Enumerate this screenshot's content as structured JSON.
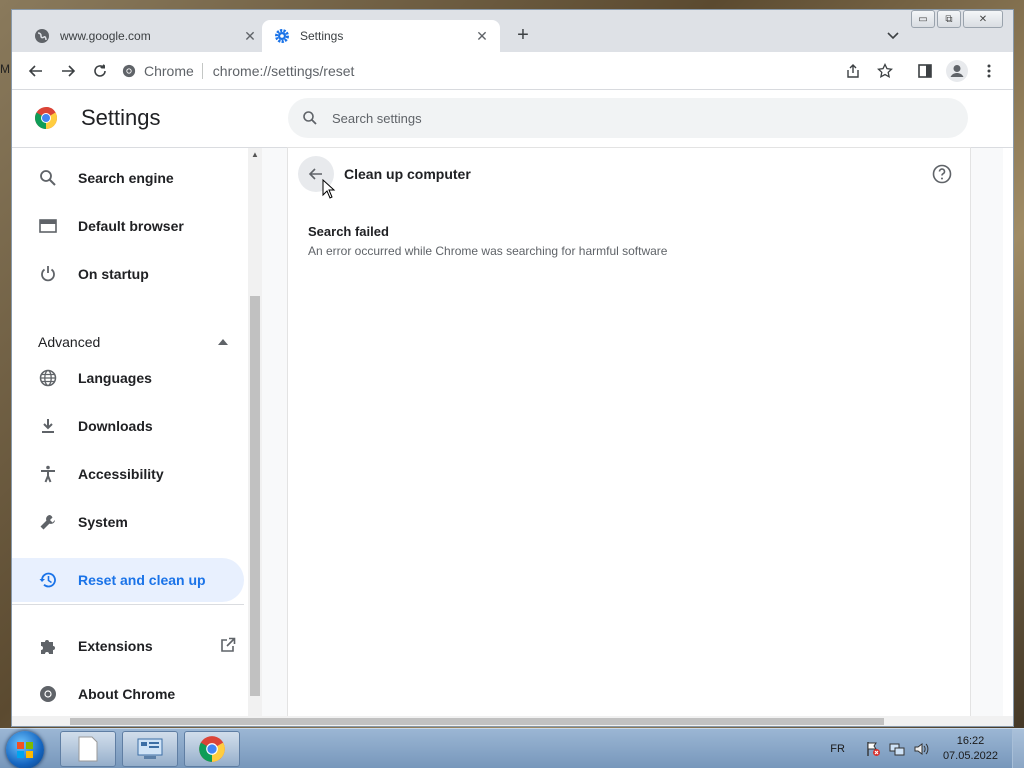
{
  "desktop": {
    "left_text": "M"
  },
  "tabs": [
    {
      "title": "www.google.com",
      "close": "✕"
    },
    {
      "title": "Settings",
      "close": "✕"
    }
  ],
  "new_tab": "+",
  "window_controls": {
    "minimize": "▭",
    "restore": "⧉",
    "close": "✕"
  },
  "omnibox": {
    "site": "Chrome",
    "url": "chrome://settings/reset"
  },
  "header": {
    "title": "Settings",
    "search_placeholder": "Search settings"
  },
  "sidebar": {
    "items": [
      {
        "label": "Search engine",
        "icon": "search-icon"
      },
      {
        "label": "Default browser",
        "icon": "browser-icon"
      },
      {
        "label": "On startup",
        "icon": "power-icon"
      },
      {
        "label": "Languages",
        "icon": "globe-icon"
      },
      {
        "label": "Downloads",
        "icon": "download-icon"
      },
      {
        "label": "Accessibility",
        "icon": "accessibility-icon"
      },
      {
        "label": "System",
        "icon": "wrench-icon"
      },
      {
        "label": "Reset and clean up",
        "icon": "restore-icon"
      },
      {
        "label": "Extensions",
        "icon": "puzzle-icon"
      },
      {
        "label": "About Chrome",
        "icon": "chrome-icon"
      }
    ],
    "advanced": "Advanced"
  },
  "main": {
    "title": "Clean up computer",
    "message_title": "Search failed",
    "message_sub": "An error occurred while Chrome was searching for harmful software"
  },
  "taskbar": {
    "lang": "FR",
    "time": "16:22",
    "date": "07.05.2022"
  },
  "colors": {
    "accent": "#1a73e8",
    "selected_bg": "#e8f0fe",
    "tab_strip": "#dee1e6"
  }
}
